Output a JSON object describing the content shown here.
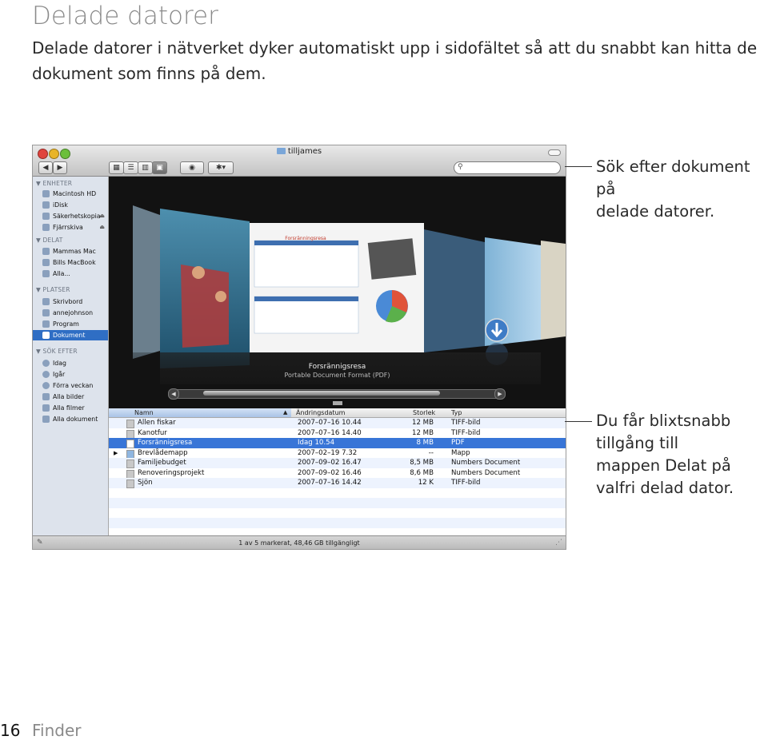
{
  "page": {
    "title": "Delade datorer",
    "intro": "Delade datorer i nätverket dyker automatiskt upp i sidofältet så att du snabbt kan hitta de dokument som finns på dem.",
    "callout_search_1": "Sök efter dokument på",
    "callout_search_2": "delade datorer.",
    "callout_shared_1": "Du får blixtsnabb",
    "callout_shared_2": "tillgång till",
    "callout_shared_3": "mappen Delat på",
    "callout_shared_4": "valfri delad dator.",
    "page_number": "16",
    "chapter": "Finder"
  },
  "window": {
    "title": "tilljames",
    "nav_back": "◀",
    "nav_forward": "▶",
    "view_icon": "▦",
    "view_list": "☰",
    "view_columns": "▥",
    "view_coverflow": "▣",
    "quicklook": "◉",
    "action": "✱▾",
    "search_icon": "⚲",
    "status_text": "1 av 5 markerat, 48,46 GB tillgängligt",
    "status_tool": "✎",
    "status_resize": "⋰"
  },
  "sidebar": {
    "sections": [
      {
        "header": "▼ ENHETER",
        "items": [
          {
            "label": "Macintosh HD",
            "eject": ""
          },
          {
            "label": "iDisk",
            "eject": ""
          },
          {
            "label": "Säkerhetskopia",
            "eject": "⏏"
          },
          {
            "label": "Fjärrskiva",
            "eject": "⏏"
          }
        ]
      },
      {
        "header": "▼ DELAT",
        "items": [
          {
            "label": "Mammas Mac",
            "eject": ""
          },
          {
            "label": "Bills MacBook",
            "eject": ""
          },
          {
            "label": "Alla...",
            "eject": ""
          }
        ]
      },
      {
        "header": "▼ PLATSER",
        "items": [
          {
            "label": "Skrivbord",
            "eject": ""
          },
          {
            "label": "annejohnson",
            "eject": ""
          },
          {
            "label": "Program",
            "eject": ""
          },
          {
            "label": "Dokument",
            "eject": ""
          }
        ]
      },
      {
        "header": "▼ SÖK EFTER",
        "items": [
          {
            "label": "Idag",
            "eject": ""
          },
          {
            "label": "Igår",
            "eject": ""
          },
          {
            "label": "Förra veckan",
            "eject": ""
          },
          {
            "label": "Alla bilder",
            "eject": ""
          },
          {
            "label": "Alla filmer",
            "eject": ""
          },
          {
            "label": "Alla dokument",
            "eject": ""
          }
        ]
      }
    ]
  },
  "coverflow": {
    "name": "Forsrännigsresa",
    "kind": "Portable Document Format (PDF)",
    "doc_title": "Forsränningsresa",
    "scroll_left": "◀",
    "scroll_right": "▶"
  },
  "list": {
    "columns": {
      "name": "Namn",
      "sort_indicator": "▲",
      "date": "Ändringsdatum",
      "size": "Storlek",
      "kind": "Typ"
    },
    "rows": [
      {
        "name": "Allen fiskar",
        "date": "2007–07–16 10.44",
        "size": "12 MB",
        "kind": "TIFF-bild",
        "disclosure": ""
      },
      {
        "name": "Kanotfur",
        "date": "2007–07–16 14.40",
        "size": "12 MB",
        "kind": "TIFF-bild",
        "disclosure": ""
      },
      {
        "name": "Forsrännigsresa",
        "date": "Idag 10.54",
        "size": "8 MB",
        "kind": "PDF",
        "disclosure": ""
      },
      {
        "name": "Brevlådemapp",
        "date": "2007–02–19 7.32",
        "size": "--",
        "kind": "Mapp",
        "disclosure": "▶"
      },
      {
        "name": "Familjebudget",
        "date": "2007–09–02 16.47",
        "size": "8,5 MB",
        "kind": "Numbers Document",
        "disclosure": ""
      },
      {
        "name": "Renoveringsprojekt",
        "date": "2007–09–02 16.46",
        "size": "8,6 MB",
        "kind": "Numbers Document",
        "disclosure": ""
      },
      {
        "name": "Sjön",
        "date": "2007–07–16 14.42",
        "size": "12 K",
        "kind": "TIFF-bild",
        "disclosure": ""
      }
    ]
  },
  "colors": {
    "selection": "#3875d7",
    "sidebar_bg": "#dde3ec",
    "title_gray": "#8a8a8a"
  }
}
